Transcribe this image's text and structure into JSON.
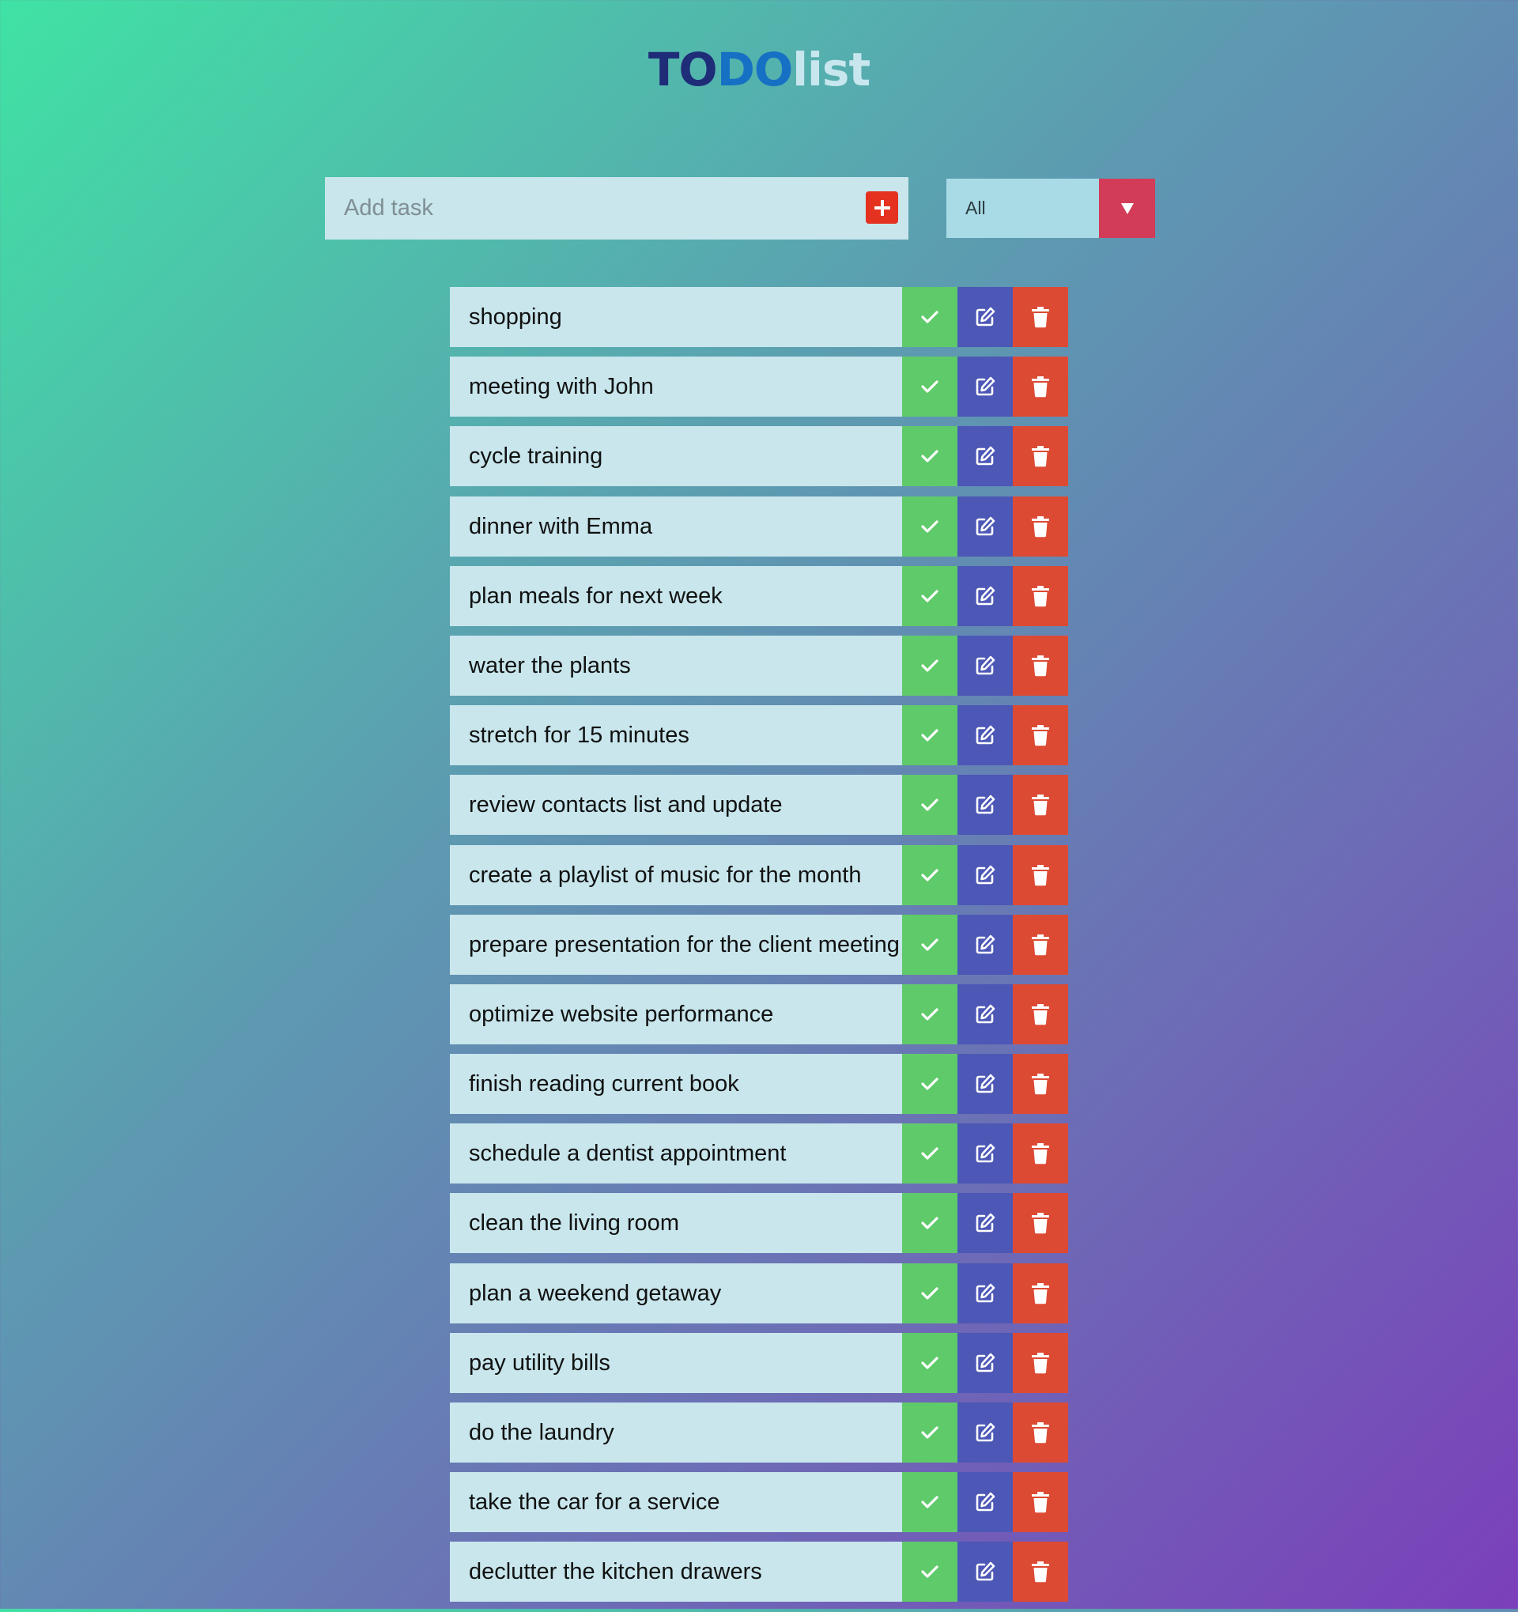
{
  "title": {
    "part1": "TO",
    "part2": "DO",
    "part3": "list"
  },
  "add_task": {
    "placeholder": "Add task",
    "button_icon": "plus-icon"
  },
  "filter": {
    "selected": "All",
    "arrow_icon": "triangle-down-icon"
  },
  "row_icons": {
    "complete": "check-icon",
    "edit": "edit-icon",
    "delete": "trash-icon"
  },
  "colors": {
    "complete": "#5fca6a",
    "edit": "#4c57b6",
    "delete": "#dd4a34",
    "add_button": "#e5311f",
    "filter_arrow": "#d23c58"
  },
  "tasks": [
    "shopping",
    "meeting with John",
    "cycle training",
    "dinner with Emma",
    "plan meals for next week",
    "water the plants",
    "stretch for 15 minutes",
    "review contacts list and update",
    "create a playlist of music for the month",
    "prepare presentation for the client meeting",
    "optimize website performance",
    "finish reading current book",
    "schedule a dentist appointment",
    "clean the living room",
    "plan a weekend getaway",
    "pay utility bills",
    "do the laundry",
    "take the car for a service",
    "declutter the kitchen drawers"
  ]
}
